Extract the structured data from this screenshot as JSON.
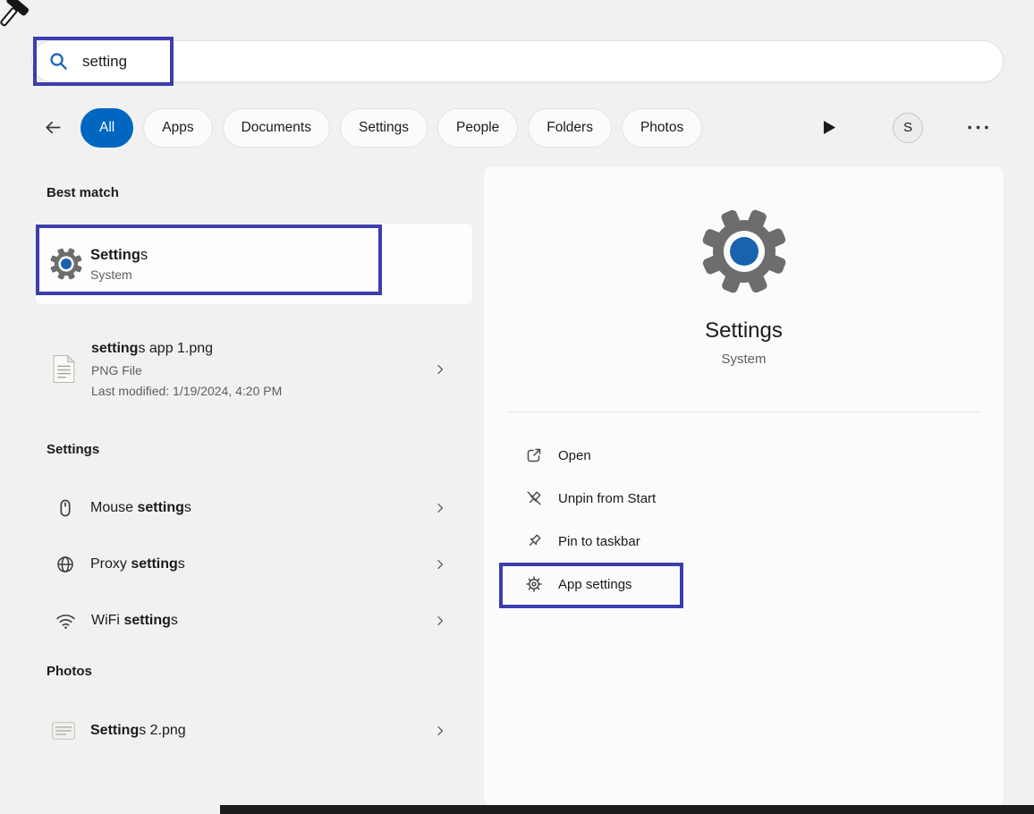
{
  "colors": {
    "accent_blue": "#0067c0",
    "annotation_box": "#3d3dae",
    "search_icon_blue": "#2166b4",
    "gear_gray": "#6d6d6d",
    "gear_center_blue": "#1962ae"
  },
  "search": {
    "value": "setting"
  },
  "toolbar": {
    "tabs": [
      {
        "label": "All",
        "active": true
      },
      {
        "label": "Apps"
      },
      {
        "label": "Documents"
      },
      {
        "label": "Settings"
      },
      {
        "label": "People"
      },
      {
        "label": "Folders"
      },
      {
        "label": "Photos"
      }
    ],
    "avatar_letter": "S"
  },
  "results": {
    "best_match_header": "Best match",
    "best_match": {
      "title_match": "Setting",
      "title_rest": "s",
      "subtitle": "System"
    },
    "file": {
      "title_match": "setting",
      "title_rest": "s app 1.png",
      "file_type": "PNG File",
      "modified": "Last modified: 1/19/2024, 4:20 PM"
    },
    "settings_header": "Settings",
    "settings_items": [
      {
        "prefix": "Mouse ",
        "match": "setting",
        "rest": "s"
      },
      {
        "prefix": "Proxy ",
        "match": "setting",
        "rest": "s"
      },
      {
        "prefix": "WiFi ",
        "match": "setting",
        "rest": "s"
      }
    ],
    "photos_header": "Photos",
    "photo_item": {
      "match": "Setting",
      "rest": "s 2.png"
    }
  },
  "preview": {
    "title": "Settings",
    "subtitle": "System",
    "actions": [
      {
        "label": "Open"
      },
      {
        "label": "Unpin from Start"
      },
      {
        "label": "Pin to taskbar"
      },
      {
        "label": "App settings"
      }
    ]
  }
}
